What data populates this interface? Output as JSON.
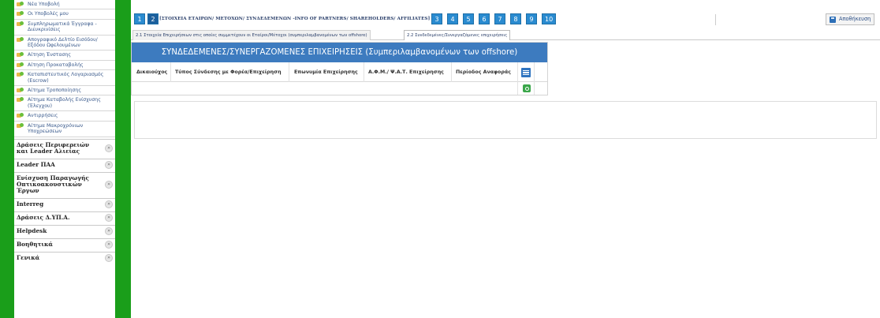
{
  "sidebar": {
    "links": [
      "Νέα Υποβολή",
      "Οι Υποβολές μου",
      "Συμπληρωματικά Έγγραφα - Διευκρινίσεις",
      "Απογραφικό Δελτίο Εισόδου/ Εξόδου Ωφελουμένων",
      "Αίτηση Ένστασης",
      "Αίτηση Προκαταβολής",
      "Καταπιστευτικός Λογαριασμός (Escrow)",
      "Αίτημα Τροποποίησης",
      "Αίτημα Καταβολής Ενίσχυσης (Έλεγχου)",
      "Αντιρρήσεις",
      "Αίτημα Μακροχρόνιων Υποχρεώσεων"
    ],
    "sections": [
      "Δράσεις Περιφερειών και Leader Αλιείας",
      "Leader ΠΑΑ",
      "Ενίσχυση Παραγωγής Οπτικοακουστικών Έργων",
      "Interreg",
      "Δράσεις Δ.ΥΠ.Α.",
      "Helpdesk",
      "Βοηθητικά",
      "Γενικά"
    ],
    "chevron": "»"
  },
  "topbar": {
    "steps": [
      "1",
      "2",
      "3",
      "4",
      "5",
      "6",
      "7",
      "8",
      "9",
      "10"
    ],
    "active_step": "2",
    "active_title": "[ΣΤΟΙΧΕΙΑ ΕΤΑΙΡΩΝ/ ΜΕΤΟΧΩΝ/ ΣΥΝΔΕΔΕΜΕΝΩΝ -INFO OF PARTNERS/ SHAREHOLDERS/ AFFILIATES]",
    "save_label": "Αποθήκευση"
  },
  "subtabs": [
    "2.1 Στοιχεία Επιχειρήσεων στις οποίες συμμετέχουν οι Εταίροι/Μέτοχοι (συμπεριλαμβανομένων των offshore)",
    "2.2 Συνδεδεμένες/Συνεργαζόμενες επιχειρήσεις"
  ],
  "active_subtab": 1,
  "panel": {
    "title": "ΣΥΝΔΕΔΕΜΕΝΕΣ/ΣΥΝΕΡΓΑΖΟΜΕΝΕΣ ΕΠΙΧΕΙΡΗΣΕΙΣ (Συμπεριλαμβανομένων των offshore)",
    "columns": [
      "Δικαιούχος",
      "Τύπος Σύνδεσης με Φορέα/Επιχείρηση",
      "Επωνυμία Επιχείρησης",
      "Α.Φ.Μ./ Ψ.Α.Τ. Επιχείρησης",
      "Περίοδος Αναφοράς"
    ]
  },
  "colors": {
    "sidebar_green": "#1a9e1a",
    "step_blue": "#2a8bd0",
    "panel_header_blue": "#3d7bbf",
    "add_green": "#3aa64a"
  }
}
